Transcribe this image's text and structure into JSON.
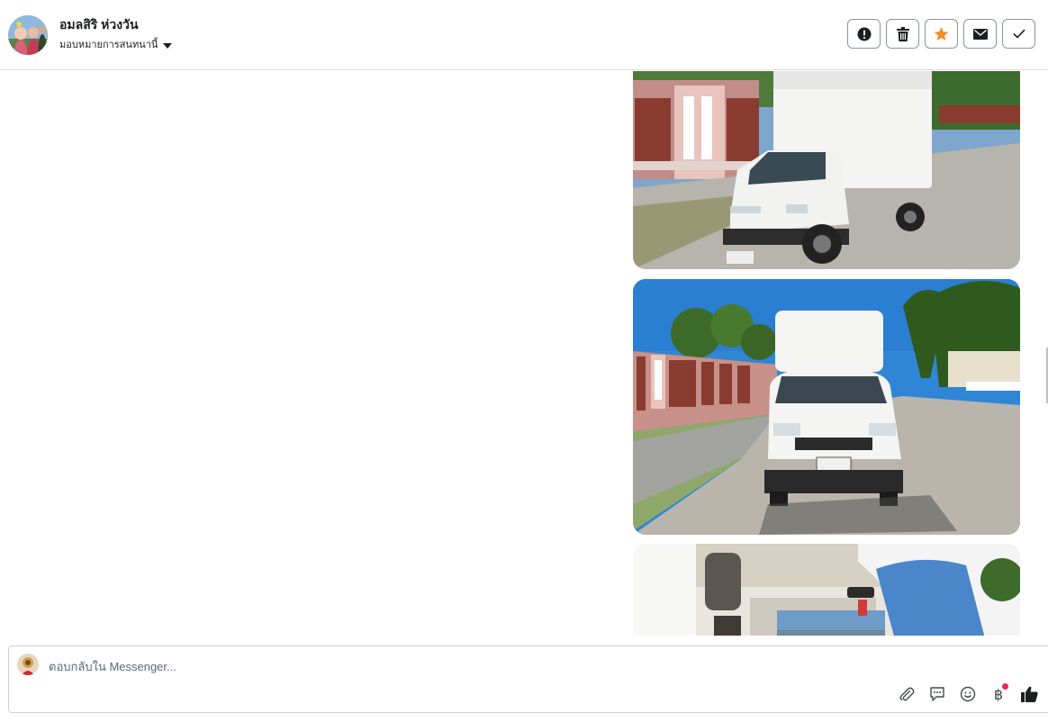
{
  "header": {
    "contact_name": "อมลสิริ ห่วงวัน",
    "assign_label": "มอบหมายการสนทนานี้",
    "actions": [
      {
        "name": "report-button",
        "icon": "alert-circle-icon"
      },
      {
        "name": "delete-button",
        "icon": "trash-icon"
      },
      {
        "name": "star-button",
        "icon": "star-icon"
      },
      {
        "name": "mark-unread-button",
        "icon": "envelope-icon"
      },
      {
        "name": "mark-done-button",
        "icon": "check-icon"
      }
    ]
  },
  "composer": {
    "placeholder": "ตอบกลับใน Messenger...",
    "tools": [
      "paperclip-icon",
      "chat-bubble-icon",
      "emoji-icon",
      "baht-icon",
      "thumbs-up-icon"
    ],
    "baht_symbol": "฿"
  },
  "colors": {
    "star": "#f08c2a",
    "notification_dot": "#f02849",
    "border": "#dadde1"
  }
}
